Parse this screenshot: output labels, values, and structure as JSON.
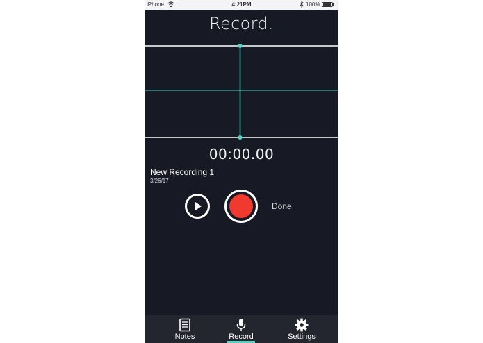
{
  "status_bar": {
    "carrier": "iPhone",
    "time": "4:21PM",
    "battery_percent": "100%",
    "battery_level": 1.0
  },
  "header": {
    "title": "Record",
    "title_accent": "."
  },
  "recorder": {
    "timer": "00:00.00",
    "recording_name": "New Recording 1",
    "recording_date": "3/26/17",
    "done_label": "Done"
  },
  "tabs": [
    {
      "label": "Notes",
      "icon": "notes-icon",
      "active": false
    },
    {
      "label": "Record",
      "icon": "microphone-icon",
      "active": true
    },
    {
      "label": "Settings",
      "icon": "gear-icon",
      "active": false
    }
  ],
  "colors": {
    "background": "#171924",
    "accent": "#4ed3c3",
    "record": "#f03a2f",
    "tab_bar": "#24262f"
  }
}
